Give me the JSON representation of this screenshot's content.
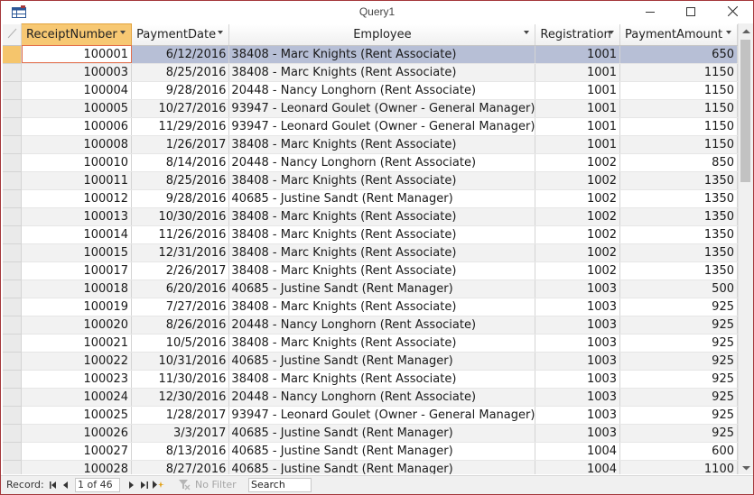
{
  "window": {
    "title": "Query1"
  },
  "columns": [
    {
      "label": "ReceiptNumber",
      "dropdown": true
    },
    {
      "label": "PaymentDate",
      "dropdown": true
    },
    {
      "label": "Employee",
      "dropdown": true
    },
    {
      "label": "Registration",
      "dropdown": true
    },
    {
      "label": "PaymentAmount",
      "dropdown": true
    }
  ],
  "rows": [
    [
      "100001",
      "6/12/2016",
      "38408 - Marc Knights (Rent Associate)",
      "1001",
      "650"
    ],
    [
      "100003",
      "8/25/2016",
      "38408 - Marc Knights (Rent Associate)",
      "1001",
      "1150"
    ],
    [
      "100004",
      "9/28/2016",
      "20448 - Nancy Longhorn (Rent Associate)",
      "1001",
      "1150"
    ],
    [
      "100005",
      "10/27/2016",
      "93947 - Leonard Goulet (Owner - General Manager)",
      "1001",
      "1150"
    ],
    [
      "100006",
      "11/29/2016",
      "93947 - Leonard Goulet (Owner - General Manager)",
      "1001",
      "1150"
    ],
    [
      "100008",
      "1/26/2017",
      "38408 - Marc Knights (Rent Associate)",
      "1001",
      "1150"
    ],
    [
      "100010",
      "8/14/2016",
      "20448 - Nancy Longhorn (Rent Associate)",
      "1002",
      "850"
    ],
    [
      "100011",
      "8/25/2016",
      "38408 - Marc Knights (Rent Associate)",
      "1002",
      "1350"
    ],
    [
      "100012",
      "9/28/2016",
      "40685 - Justine Sandt (Rent Manager)",
      "1002",
      "1350"
    ],
    [
      "100013",
      "10/30/2016",
      "38408 - Marc Knights (Rent Associate)",
      "1002",
      "1350"
    ],
    [
      "100014",
      "11/26/2016",
      "38408 - Marc Knights (Rent Associate)",
      "1002",
      "1350"
    ],
    [
      "100015",
      "12/31/2016",
      "38408 - Marc Knights (Rent Associate)",
      "1002",
      "1350"
    ],
    [
      "100017",
      "2/26/2017",
      "38408 - Marc Knights (Rent Associate)",
      "1002",
      "1350"
    ],
    [
      "100018",
      "6/20/2016",
      "40685 - Justine Sandt (Rent Manager)",
      "1003",
      "500"
    ],
    [
      "100019",
      "7/27/2016",
      "38408 - Marc Knights (Rent Associate)",
      "1003",
      "925"
    ],
    [
      "100020",
      "8/26/2016",
      "20448 - Nancy Longhorn (Rent Associate)",
      "1003",
      "925"
    ],
    [
      "100021",
      "10/5/2016",
      "38408 - Marc Knights (Rent Associate)",
      "1003",
      "925"
    ],
    [
      "100022",
      "10/31/2016",
      "40685 - Justine Sandt (Rent Manager)",
      "1003",
      "925"
    ],
    [
      "100023",
      "11/30/2016",
      "38408 - Marc Knights (Rent Associate)",
      "1003",
      "925"
    ],
    [
      "100024",
      "12/30/2016",
      "20448 - Nancy Longhorn (Rent Associate)",
      "1003",
      "925"
    ],
    [
      "100025",
      "1/28/2017",
      "93947 - Leonard Goulet (Owner - General Manager)",
      "1003",
      "925"
    ],
    [
      "100026",
      "3/3/2017",
      "40685 - Justine Sandt (Rent Manager)",
      "1003",
      "925"
    ],
    [
      "100027",
      "8/13/2016",
      "40685 - Justine Sandt (Rent Manager)",
      "1004",
      "600"
    ],
    [
      "100028",
      "8/27/2016",
      "40685 - Justine Sandt (Rent Manager)",
      "1004",
      "1100"
    ]
  ],
  "selected_row": 0,
  "navbar": {
    "record_label": "Record:",
    "position": "1 of 46",
    "filter_label": "No Filter",
    "search_placeholder": "Search"
  },
  "colors": {
    "window_border": "#a4373a",
    "active_header": "#f7c873",
    "selected_row": "#b7bfd6",
    "alt_row": "#f2f2f2"
  },
  "icons": [
    "datasheet-icon",
    "minimize-icon",
    "maximize-icon",
    "close-icon",
    "first-record-icon",
    "previous-record-icon",
    "next-record-icon",
    "last-record-icon",
    "new-record-icon",
    "filter-icon",
    "scroll-up-icon",
    "scroll-down-icon"
  ]
}
